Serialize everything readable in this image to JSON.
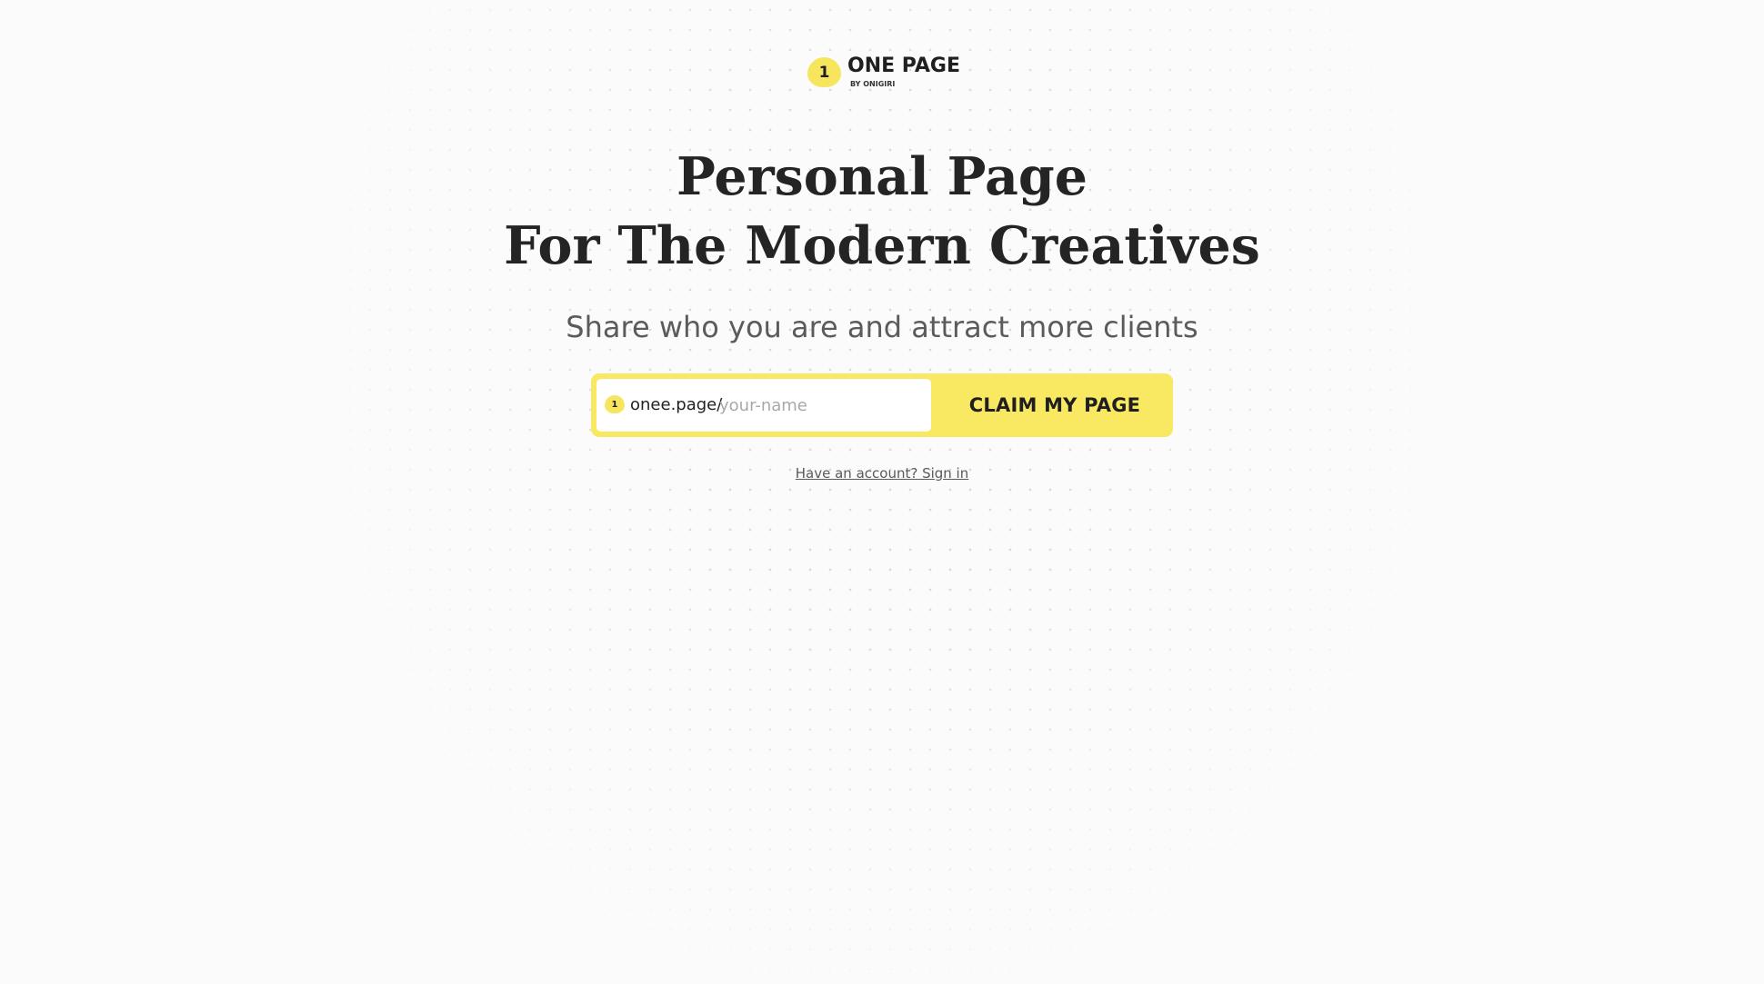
{
  "logo": {
    "badge": "1",
    "title": "ONE PAGE",
    "subtitle": "BY ONIGIRI"
  },
  "hero": {
    "headline_line1": "Personal Page",
    "headline_line2": "For The Modern Creatives",
    "subheadline": "Share who you are and attract more clients"
  },
  "claim_form": {
    "badge": "1",
    "url_prefix": "onee.page/",
    "input_value": "",
    "input_placeholder": "your-name",
    "button_label": "CLAIM MY PAGE"
  },
  "signin": {
    "link_text": "Have an account? Sign in"
  },
  "colors": {
    "accent_yellow": "#f8e862",
    "background": "#fbfbfb",
    "text_dark": "#242424",
    "text_muted": "#5b5b5b"
  },
  "icons": {
    "logo_badge": "onigiri-one-icon",
    "input_badge": "onigiri-one-icon"
  }
}
